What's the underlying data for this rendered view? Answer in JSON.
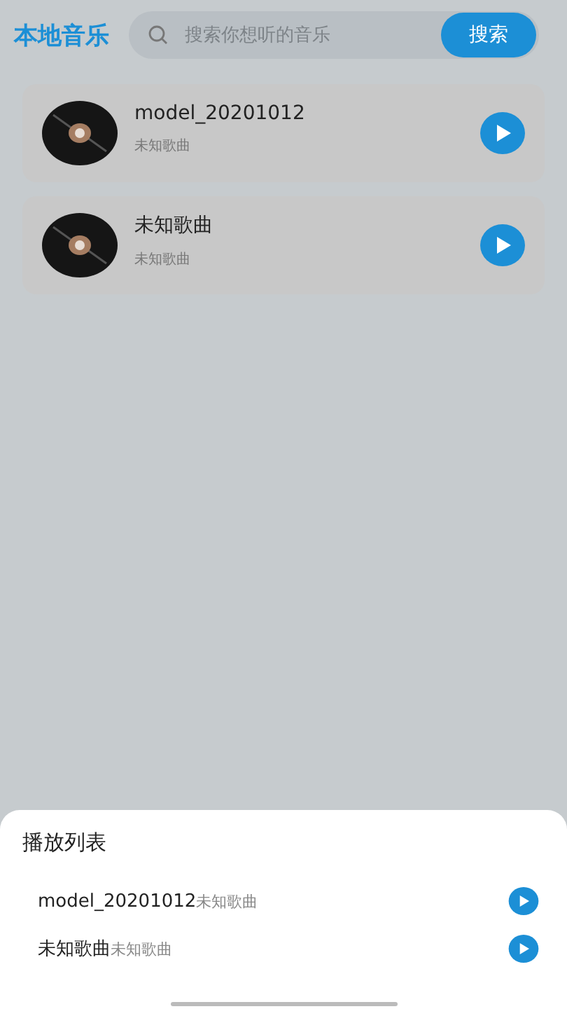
{
  "header": {
    "title": "本地音乐",
    "search": {
      "placeholder": "搜索你想听的音乐"
    },
    "search_button": "搜索"
  },
  "songs": [
    {
      "title": "model_20201012",
      "artist": "未知歌曲"
    },
    {
      "title": "未知歌曲",
      "artist": "未知歌曲"
    }
  ],
  "playlist_sheet": {
    "title": "播放列表",
    "items": [
      {
        "title": "model_20201012",
        "artist": "未知歌曲"
      },
      {
        "title": "未知歌曲",
        "artist": "未知歌曲"
      }
    ]
  }
}
